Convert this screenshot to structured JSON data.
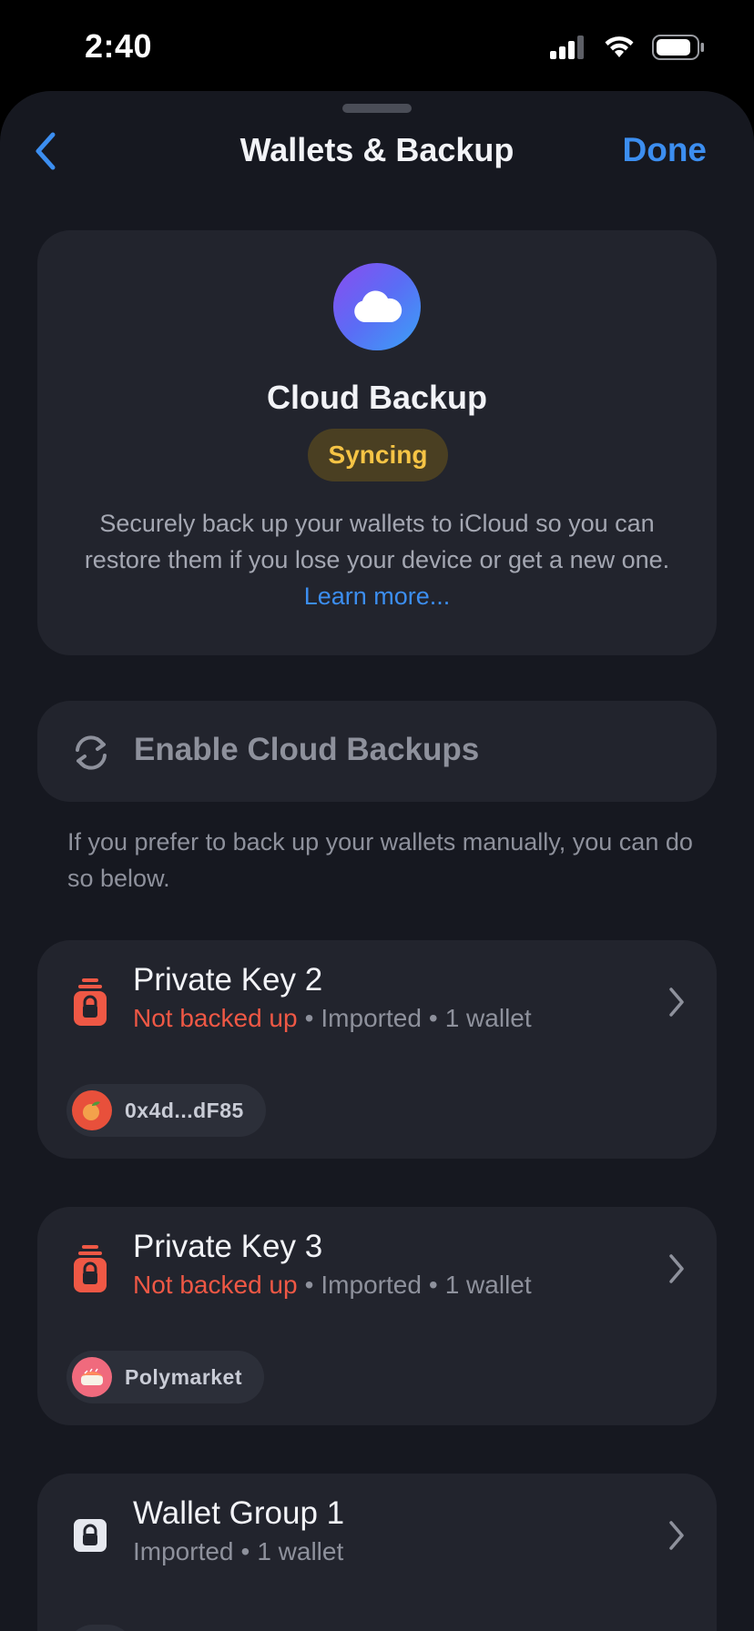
{
  "status": {
    "time": "2:40"
  },
  "nav": {
    "title": "Wallets & Backup",
    "done": "Done"
  },
  "backup": {
    "title": "Cloud Backup",
    "status": "Syncing",
    "description": "Securely back up your wallets to iCloud so you can restore them if you lose your device or get a new one.",
    "link": "Learn more..."
  },
  "enable": {
    "label": "Enable Cloud Backups"
  },
  "manual_note": "If you prefer to back up your wallets manually, you can do so below.",
  "groups": [
    {
      "title": "Private Key 2",
      "status": "Not backed up",
      "type": "Imported",
      "count": "1 wallet",
      "chip": "0x4d...dF85",
      "icon": "lock-stack-icon"
    },
    {
      "title": "Private Key 3",
      "status": "Not backed up",
      "type": "Imported",
      "count": "1 wallet",
      "chip": "Polymarket",
      "icon": "lock-stack-icon"
    },
    {
      "title": "Wallet Group 1",
      "type": "Imported",
      "count": "1 wallet",
      "icon": "lock-icon"
    }
  ],
  "colors": {
    "accent": "#3c8ef0",
    "warning": "#ef5845",
    "syncing": "#f6c445",
    "card": "#22242d",
    "sheet": "#161820"
  }
}
